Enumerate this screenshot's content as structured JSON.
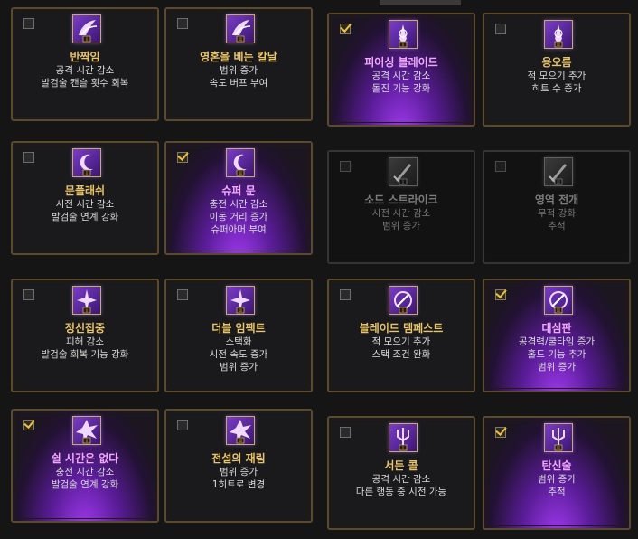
{
  "colors": {
    "title": "#e8c46a",
    "selected_title": "#f2a8ff",
    "border": "#5b4a2c",
    "purple": "#8a30e0"
  },
  "cards": [
    {
      "title": "반짝임",
      "lines": [
        "공격 시간 감소",
        "발검술 캔슬 횟수 회복"
      ],
      "checked": false,
      "selected": false,
      "locked": false,
      "icon": "wing-icon",
      "tier": "I"
    },
    {
      "title": "영혼을 베는 칼날",
      "lines": [
        "범위 증가",
        "속도 버프 부여"
      ],
      "checked": false,
      "selected": false,
      "locked": false,
      "icon": "wing-icon",
      "tier": "II"
    },
    {
      "title": "피어싱 블레이드",
      "lines": [
        "공격 시간 감소",
        "돌진 기능 강화"
      ],
      "checked": true,
      "selected": true,
      "locked": false,
      "icon": "blade-icon",
      "tier": "I"
    },
    {
      "title": "용오름",
      "lines": [
        "적 모으기 추가",
        "히트 수 증가"
      ],
      "checked": false,
      "selected": false,
      "locked": false,
      "icon": "blade-icon",
      "tier": "II"
    },
    {
      "title": "문플래쉬",
      "lines": [
        "시전 시간 감소",
        "발검술 연계 강화"
      ],
      "checked": false,
      "selected": false,
      "locked": false,
      "icon": "moon-icon",
      "tier": "I"
    },
    {
      "title": "슈퍼 문",
      "lines": [
        "충전 시간 감소",
        "이동 거리 증가",
        "슈퍼아머 부여"
      ],
      "checked": true,
      "selected": true,
      "locked": false,
      "icon": "moon-icon",
      "tier": "II"
    },
    {
      "title": "소드 스트라이크",
      "lines": [
        "시전 시간 감소",
        "범위 증가"
      ],
      "checked": false,
      "selected": false,
      "locked": true,
      "icon": "sword-icon",
      "tier": "I"
    },
    {
      "title": "영역 전개",
      "lines": [
        "무적 강화",
        "추적"
      ],
      "checked": false,
      "selected": false,
      "locked": true,
      "icon": "sword-icon",
      "tier": "II"
    },
    {
      "title": "정신집중",
      "lines": [
        "피해 감소",
        "발검술 회복 기능 강화"
      ],
      "checked": false,
      "selected": false,
      "locked": false,
      "icon": "star-icon",
      "tier": "I"
    },
    {
      "title": "더블 임팩트",
      "lines": [
        "스택화",
        "시전 속도 증가",
        "범위 증가"
      ],
      "checked": false,
      "selected": false,
      "locked": false,
      "icon": "star-icon",
      "tier": "II"
    },
    {
      "title": "블레이드 템페스트",
      "lines": [
        "적 모으기 추가",
        "스택 조건 완화"
      ],
      "checked": false,
      "selected": false,
      "locked": false,
      "icon": "tempest-icon",
      "tier": "I"
    },
    {
      "title": "대심판",
      "lines": [
        "공격력/쿨타임 증가",
        "홀드 기능 추가",
        "범위 증가"
      ],
      "checked": true,
      "selected": true,
      "locked": false,
      "icon": "tempest-icon",
      "tier": "II"
    },
    {
      "title": "쉴 시간은 없다",
      "lines": [
        "충전 시간 감소",
        "발검술 연계 강화"
      ],
      "checked": true,
      "selected": true,
      "locked": false,
      "icon": "burst-icon",
      "tier": "I"
    },
    {
      "title": "전설의 재림",
      "lines": [
        "범위 증가",
        "1히트로 변경"
      ],
      "checked": false,
      "selected": false,
      "locked": false,
      "icon": "burst-icon",
      "tier": "II"
    },
    {
      "title": "서든 콜",
      "lines": [
        "공격 시간 감소",
        "다른 행동 중 시전 가능"
      ],
      "checked": false,
      "selected": false,
      "locked": false,
      "icon": "trident-icon",
      "tier": "I"
    },
    {
      "title": "탄신술",
      "lines": [
        "범위 증가",
        "추적"
      ],
      "checked": true,
      "selected": true,
      "locked": false,
      "icon": "trident-icon",
      "tier": "II"
    }
  ]
}
